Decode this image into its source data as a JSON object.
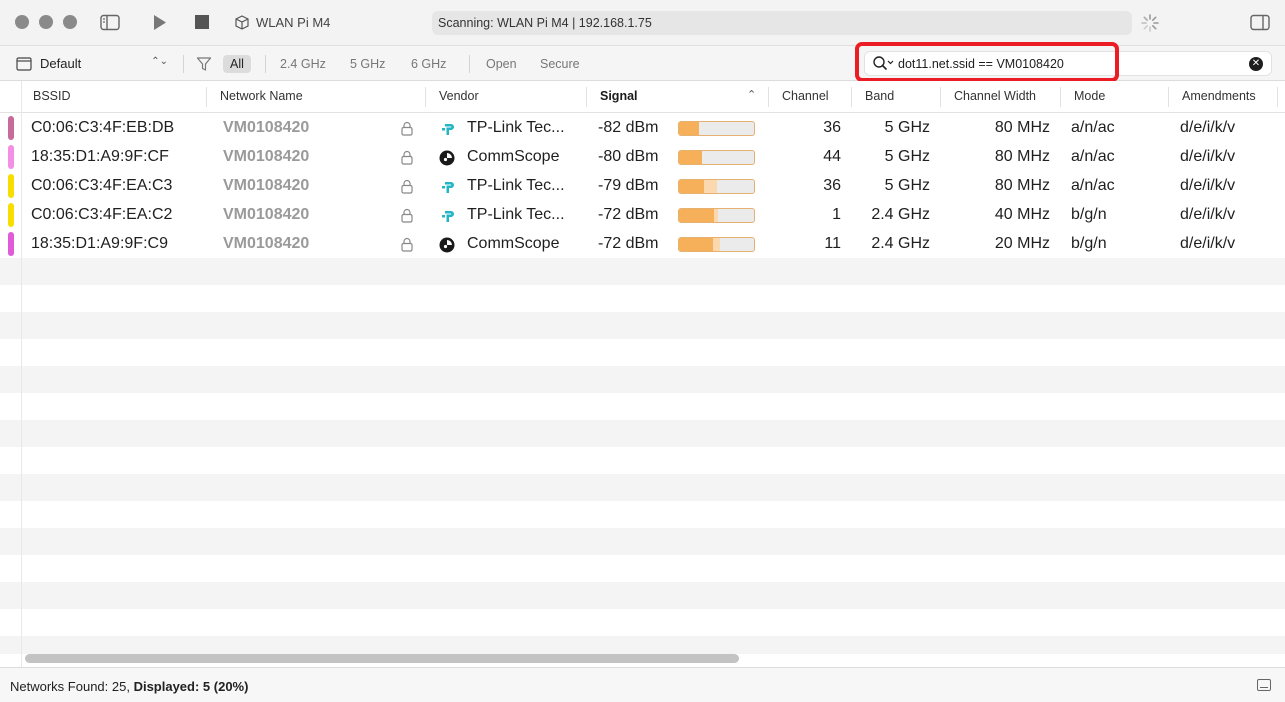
{
  "toolbar": {
    "device_name": "WLAN Pi M4",
    "status": "Scanning: WLAN Pi M4 | 192.168.1.75"
  },
  "filterbar": {
    "profile": "Default",
    "filters": [
      "All",
      "2.4 GHz",
      "5 GHz",
      "6 GHz"
    ],
    "security_filters": [
      "Open",
      "Secure"
    ],
    "active_filter": "All",
    "search_value": "dot11.net.ssid == VM0108420"
  },
  "table": {
    "headers": {
      "bssid": "BSSID",
      "network_name": "Network Name",
      "vendor": "Vendor",
      "signal": "Signal",
      "channel": "Channel",
      "band": "Band",
      "channel_width": "Channel Width",
      "mode": "Mode",
      "amendments": "Amendments"
    },
    "sort_column": "Signal",
    "rows": [
      {
        "bssid": "C0:06:C3:4F:EB:DB",
        "ssid": "VM0108420",
        "vendor": "TP-Link Tec...",
        "vendor_icon": "tplink-icon",
        "signal": "-82 dBm",
        "signal_level": 0.26,
        "signal_peak": 0.26,
        "channel": "36",
        "band": "5 GHz",
        "width": "80 MHz",
        "mode": "a/n/ac",
        "amendments": "d/e/i/k/v",
        "color": "#c76b9a"
      },
      {
        "bssid": "18:35:D1:A9:9F:CF",
        "ssid": "VM0108420",
        "vendor": "CommScope",
        "vendor_icon": "commscope-icon",
        "signal": "-80 dBm",
        "signal_level": 0.31,
        "signal_peak": 0.31,
        "channel": "44",
        "band": "5 GHz",
        "width": "80 MHz",
        "mode": "a/n/ac",
        "amendments": "d/e/i/k/v",
        "color": "#f38fe4"
      },
      {
        "bssid": "C0:06:C3:4F:EA:C3",
        "ssid": "VM0108420",
        "vendor": "TP-Link Tec...",
        "vendor_icon": "tplink-icon",
        "signal": "-79 dBm",
        "signal_level": 0.33,
        "signal_peak": 0.5,
        "channel": "36",
        "band": "5 GHz",
        "width": "80 MHz",
        "mode": "a/n/ac",
        "amendments": "d/e/i/k/v",
        "color": "#f7dd00"
      },
      {
        "bssid": "C0:06:C3:4F:EA:C2",
        "ssid": "VM0108420",
        "vendor": "TP-Link Tec...",
        "vendor_icon": "tplink-icon",
        "signal": "-72 dBm",
        "signal_level": 0.46,
        "signal_peak": 0.52,
        "channel": "1",
        "band": "2.4 GHz",
        "width": "40 MHz",
        "mode": "b/g/n",
        "amendments": "d/e/i/k/v",
        "color": "#f7dd00"
      },
      {
        "bssid": "18:35:D1:A9:9F:C9",
        "ssid": "VM0108420",
        "vendor": "CommScope",
        "vendor_icon": "commscope-icon",
        "signal": "-72 dBm",
        "signal_level": 0.45,
        "signal_peak": 0.54,
        "channel": "11",
        "band": "2.4 GHz",
        "width": "20 MHz",
        "mode": "b/g/n",
        "amendments": "d/e/i/k/v",
        "color": "#e05ad9"
      }
    ]
  },
  "statusbar": {
    "found_label": "Networks Found: 25, ",
    "displayed_label": "Displayed: 5 (20%)"
  }
}
